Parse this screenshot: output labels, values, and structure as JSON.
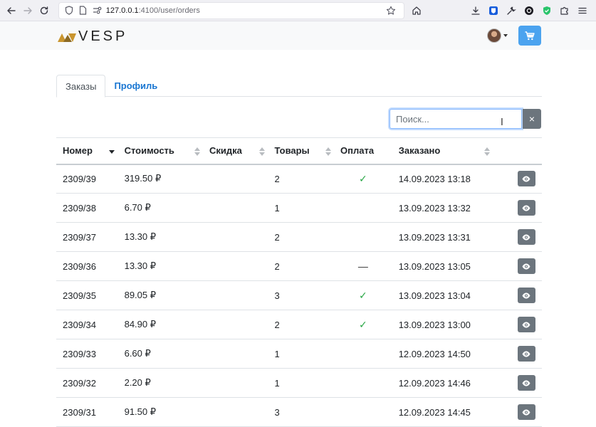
{
  "browser": {
    "url_host": "127.0.0.1",
    "url_path": ":4100/user/orders"
  },
  "header": {
    "logo_text": "VESP",
    "brand_colors": {
      "gold": "#c9952f",
      "dark": "#222222"
    },
    "cart_color": "#4ba3ef"
  },
  "tabs": [
    {
      "label": "Заказы",
      "active": true
    },
    {
      "label": "Профиль",
      "active": false
    }
  ],
  "search": {
    "placeholder": "Поиск...",
    "value": "",
    "clear_label": "×"
  },
  "table": {
    "columns": [
      {
        "label": "Номер",
        "sortable": true,
        "sort": "desc"
      },
      {
        "label": "Стоимость",
        "sortable": true
      },
      {
        "label": "Скидка",
        "sortable": true
      },
      {
        "label": "Товары",
        "sortable": true
      },
      {
        "label": "Оплата",
        "sortable": false
      },
      {
        "label": "Заказано",
        "sortable": true
      }
    ],
    "rows": [
      {
        "num": "2309/39",
        "cost": "319.50 ₽",
        "discount": "",
        "items": "2",
        "paid": "check",
        "date": "14.09.2023 13:18"
      },
      {
        "num": "2309/38",
        "cost": "6.70 ₽",
        "discount": "",
        "items": "1",
        "paid": "",
        "date": "13.09.2023 13:32"
      },
      {
        "num": "2309/37",
        "cost": "13.30 ₽",
        "discount": "",
        "items": "2",
        "paid": "",
        "date": "13.09.2023 13:31"
      },
      {
        "num": "2309/36",
        "cost": "13.30 ₽",
        "discount": "",
        "items": "2",
        "paid": "dash",
        "date": "13.09.2023 13:05"
      },
      {
        "num": "2309/35",
        "cost": "89.05 ₽",
        "discount": "",
        "items": "3",
        "paid": "check",
        "date": "13.09.2023 13:04"
      },
      {
        "num": "2309/34",
        "cost": "84.90 ₽",
        "discount": "",
        "items": "2",
        "paid": "check",
        "date": "13.09.2023 13:00"
      },
      {
        "num": "2309/33",
        "cost": "6.60 ₽",
        "discount": "",
        "items": "1",
        "paid": "",
        "date": "12.09.2023 14:50"
      },
      {
        "num": "2309/32",
        "cost": "2.20 ₽",
        "discount": "",
        "items": "1",
        "paid": "",
        "date": "12.09.2023 14:46"
      },
      {
        "num": "2309/31",
        "cost": "91.50 ₽",
        "discount": "",
        "items": "3",
        "paid": "",
        "date": "12.09.2023 14:45"
      }
    ],
    "paid_check_glyph": "✓",
    "paid_dash_glyph": "—"
  }
}
